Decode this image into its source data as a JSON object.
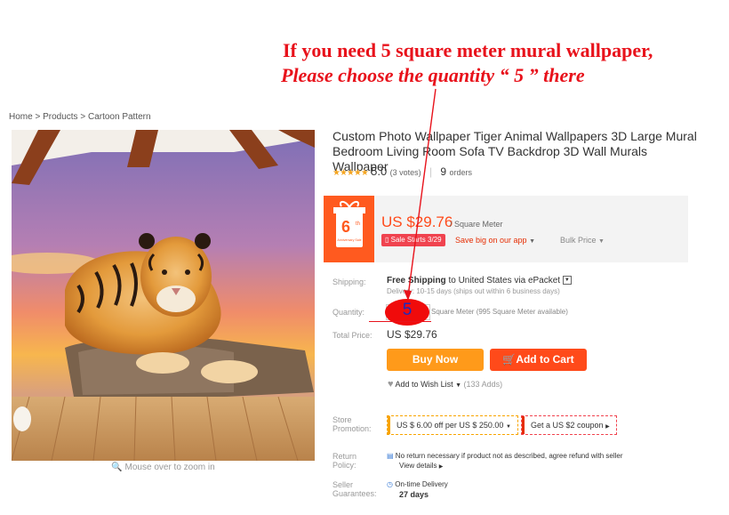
{
  "annotation": {
    "line1": "If you need  5  square meter mural wallpaper,",
    "line2": "Please choose the quantity “ 5 ”  there",
    "circled_value": "5"
  },
  "breadcrumb": {
    "home": "Home",
    "products": "Products",
    "category": "Cartoon Pattern",
    "sep": ">"
  },
  "gallery": {
    "zoom_hint": "Mouse over to zoom in"
  },
  "product": {
    "title": "Custom Photo Wallpaper Tiger Animal Wallpapers 3D Large Mural Bedroom Living Room Sofa TV Backdrop 3D Wall Murals Wallpaper",
    "stars": "★★★★★",
    "rating": "5.0",
    "votes": "(3 votes)",
    "orders_count": "9",
    "orders_label": "orders",
    "rating_value": 5.0
  },
  "price_box": {
    "badge_big": "6",
    "badge_sup": "th",
    "badge_small": "Anniversary Sale",
    "price": "US $29.76",
    "unit": "/ Square Meter",
    "sale_tag": "Sale Starts 3/29",
    "app_promo": "Save big on our app",
    "bulk": "Bulk Price",
    "accent": "#ff4a1a",
    "badge_color": "#ff5a1f"
  },
  "shipping": {
    "label": "Shipping:",
    "free": "Free Shipping",
    "to": "to",
    "destination": "United States via ePacket",
    "delivery": "Delivery: 10-15 days (ships out within 6 business days)"
  },
  "quantity": {
    "label": "Quantity:",
    "unit": "Square Meter (995 Square Meter available)"
  },
  "total": {
    "label": "Total Price:",
    "value": "US $29.76"
  },
  "buttons": {
    "buy_now": "Buy Now",
    "add_to_cart": "Add to Cart",
    "buy_color": "#ff9a1a",
    "cart_color": "#ff4a1a"
  },
  "wishlist": {
    "label": "Add to Wish List",
    "count": "(133 Adds)"
  },
  "store_promotion": {
    "label": "Store Promotion:",
    "coupon1": "US $ 6.00 off per US $ 250.00",
    "coupon2": "Get a US $2 coupon"
  },
  "return_policy": {
    "label": "Return Policy:",
    "text": "No return necessary if product not as described, agree refund with seller",
    "link": "View details"
  },
  "guarantee": {
    "label": "Seller Guarantees:",
    "text": "On-time Delivery",
    "days": "27 days"
  }
}
